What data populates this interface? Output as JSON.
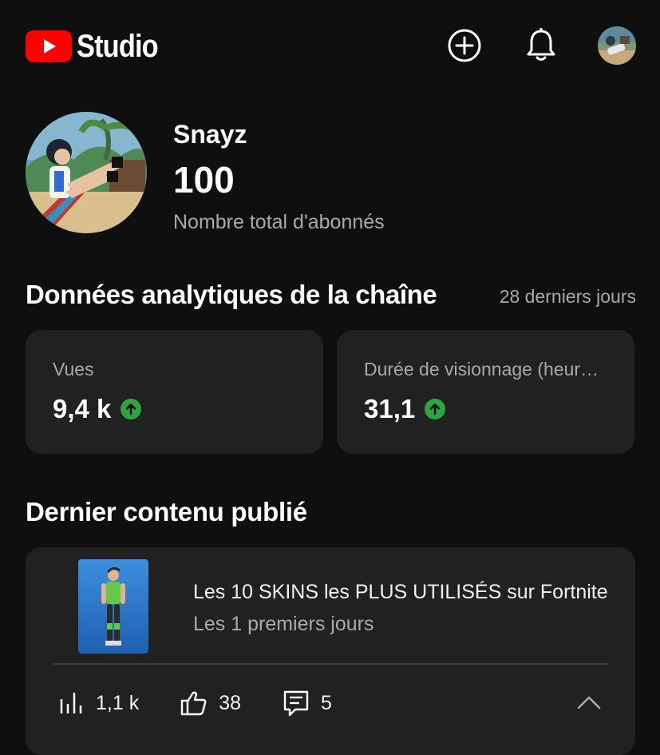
{
  "app": {
    "title": "Studio"
  },
  "colors": {
    "brand_red": "#ff0000",
    "trend_green": "#2ba640"
  },
  "icons": {
    "create": "plus-circle-icon",
    "notifications": "bell-icon",
    "trend": "arrow-up-circle-icon",
    "views": "bar-chart-icon",
    "likes": "thumbs-up-icon",
    "comments": "comment-icon",
    "collapse": "chevron-up-icon"
  },
  "channel": {
    "name": "Snayz",
    "subscribers": "100",
    "subscribers_label": "Nombre total d'abonnés"
  },
  "analytics": {
    "title": "Données analytiques de la chaîne",
    "period": "28 derniers jours",
    "metrics": [
      {
        "label": "Vues",
        "value": "9,4 k",
        "trend": "up"
      },
      {
        "label": "Durée de visionnage (heures)",
        "value": "31,1",
        "trend": "up"
      }
    ]
  },
  "latest": {
    "section_title": "Dernier contenu publié",
    "video_title": "Les 10 SKINS les PLUS UTILISÉS sur Fortnite",
    "video_subtitle": "Les 1 premiers jours",
    "stats": {
      "views": "1,1 k",
      "likes": "38",
      "comments": "5"
    }
  }
}
